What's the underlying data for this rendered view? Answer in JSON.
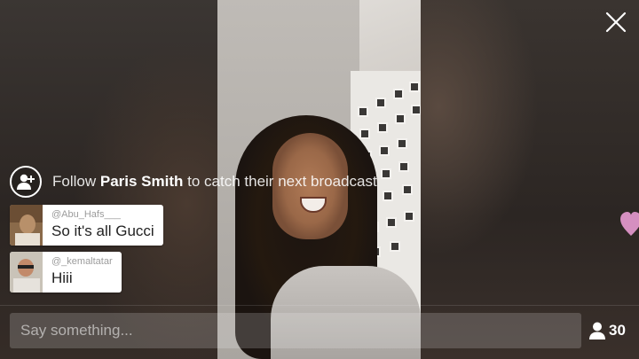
{
  "follow_banner": {
    "prefix": "Follow",
    "name": "Paris Smith",
    "suffix": "to catch their next broadcast"
  },
  "comments": [
    {
      "handle": "@Abu_Hafs___",
      "message": "So it's all Gucci"
    },
    {
      "handle": "@_kemaltatar",
      "message": "Hiii"
    }
  ],
  "composer": {
    "placeholder": "Say something..."
  },
  "viewers": {
    "count": "30"
  },
  "icons": {
    "close": "close-icon",
    "follow": "add-user-icon",
    "heart": "heart-icon",
    "viewers": "person-icon"
  },
  "colors": {
    "heart": "#d58fc0",
    "bubble_bg": "#ffffff"
  }
}
